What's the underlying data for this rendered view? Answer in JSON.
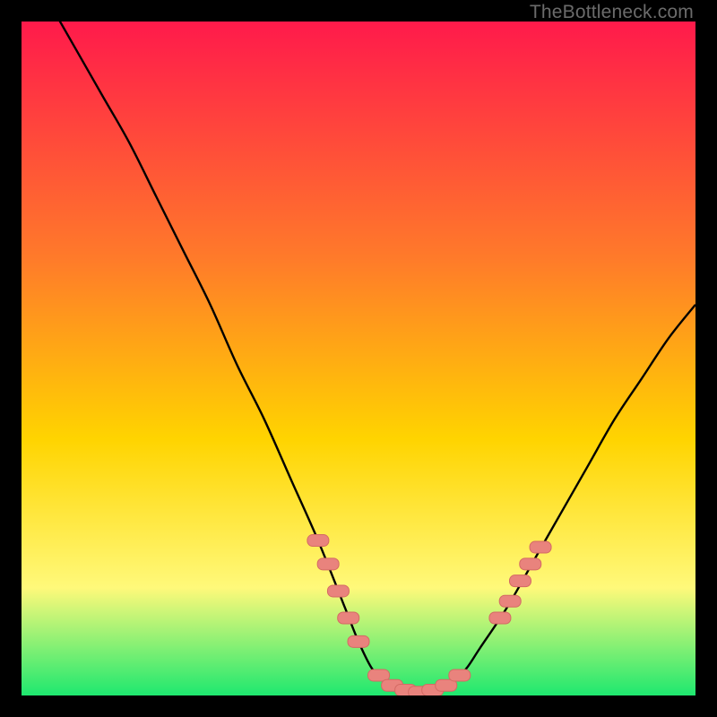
{
  "watermark": "TheBottleneck.com",
  "colors": {
    "gradient_top": "#ff1a4b",
    "gradient_mid1": "#ff7a2a",
    "gradient_mid2": "#ffd400",
    "gradient_mid3": "#fff97a",
    "gradient_bottom": "#1ee86f",
    "curve": "#000000",
    "marker_fill": "#e9837d",
    "marker_stroke": "#d46a64"
  },
  "chart_data": {
    "type": "line",
    "title": "",
    "xlabel": "",
    "ylabel": "",
    "xlim": [
      0,
      100
    ],
    "ylim": [
      0,
      100
    ],
    "series": [
      {
        "name": "bottleneck-curve",
        "x": [
          0,
          4,
          8,
          12,
          16,
          20,
          24,
          28,
          32,
          36,
          40,
          44,
          48,
          50,
          52,
          54,
          56,
          58,
          60,
          62,
          64,
          66,
          68,
          72,
          76,
          80,
          84,
          88,
          92,
          96,
          100
        ],
        "y": [
          110,
          103,
          96,
          89,
          82,
          74,
          66,
          58,
          49,
          41,
          32,
          23,
          13,
          8,
          4,
          2,
          1,
          0.5,
          0.5,
          1,
          2,
          4,
          7,
          13,
          20,
          27,
          34,
          41,
          47,
          53,
          58
        ]
      }
    ],
    "markers": [
      {
        "name": "left-cluster",
        "points": [
          {
            "x": 44.0,
            "y": 23.0
          },
          {
            "x": 45.5,
            "y": 19.5
          },
          {
            "x": 47.0,
            "y": 15.5
          },
          {
            "x": 48.5,
            "y": 11.5
          },
          {
            "x": 50.0,
            "y": 8.0
          }
        ]
      },
      {
        "name": "bottom-cluster",
        "points": [
          {
            "x": 53.0,
            "y": 3.0
          },
          {
            "x": 55.0,
            "y": 1.5
          },
          {
            "x": 57.0,
            "y": 0.8
          },
          {
            "x": 59.0,
            "y": 0.5
          },
          {
            "x": 61.0,
            "y": 0.8
          },
          {
            "x": 63.0,
            "y": 1.5
          },
          {
            "x": 65.0,
            "y": 3.0
          }
        ]
      },
      {
        "name": "right-cluster",
        "points": [
          {
            "x": 71.0,
            "y": 11.5
          },
          {
            "x": 72.5,
            "y": 14.0
          },
          {
            "x": 74.0,
            "y": 17.0
          },
          {
            "x": 75.5,
            "y": 19.5
          },
          {
            "x": 77.0,
            "y": 22.0
          }
        ]
      }
    ]
  }
}
